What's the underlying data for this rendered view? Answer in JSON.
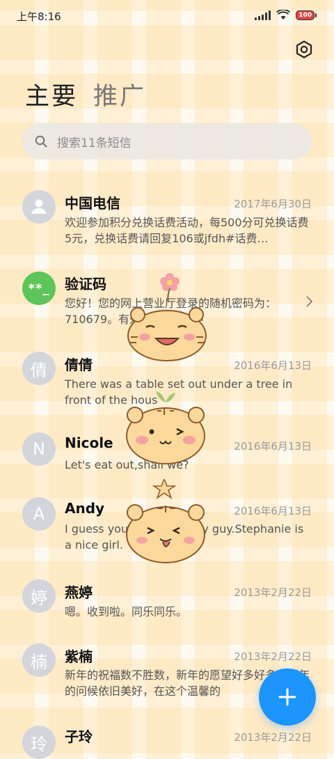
{
  "status": {
    "time": "上午8:16",
    "battery": "100"
  },
  "tabs": {
    "primary": "主要",
    "promo": "推广"
  },
  "search": {
    "placeholder": "搜索11条短信"
  },
  "conversations": [
    {
      "name": "中国电信",
      "date": "2017年6月30日",
      "preview": "欢迎参加积分兑换话费活动，每500分可兑换话费5元，兑换话费请回复106或jfdh#话费…",
      "avatar": "person-icon"
    },
    {
      "name": "验证码",
      "date": "",
      "preview": "您好！您的网上营业厅登录的随机密码为：710679。有效时间为3分钟",
      "avatar_text": "**_"
    },
    {
      "name": "倩倩",
      "date": "2016年6月13日",
      "preview": "There was a table set out under a tree in front of the hous",
      "avatar_text": "倩"
    },
    {
      "name": "Nicole",
      "date": "2016年6月13日",
      "preview": "Let's eat out,shall we?",
      "avatar_text": "N"
    },
    {
      "name": "Andy",
      "date": "2016年6月13日",
      "preview": "I guess you're some lucky guy.Stephanie is a nice girl.",
      "avatar_text": "A"
    },
    {
      "name": "燕婷",
      "date": "2013年2月22日",
      "preview": "嗯。收到啦。同乐同乐。",
      "avatar_text": "婷"
    },
    {
      "name": "紫楠",
      "date": "2013年2月22日",
      "preview": "新年的祝福数不胜数，新年的愿望好多好多，新年的问候依旧美好，在这个温馨的",
      "avatar_text": "楠"
    },
    {
      "name": "子玲",
      "date": "2013年2月22日",
      "preview": "",
      "avatar_text": "玲"
    }
  ],
  "colors": {
    "accent": "#1c95ff",
    "verify_avatar": "#5dc559",
    "avatar_gray": "#d3d5da"
  }
}
